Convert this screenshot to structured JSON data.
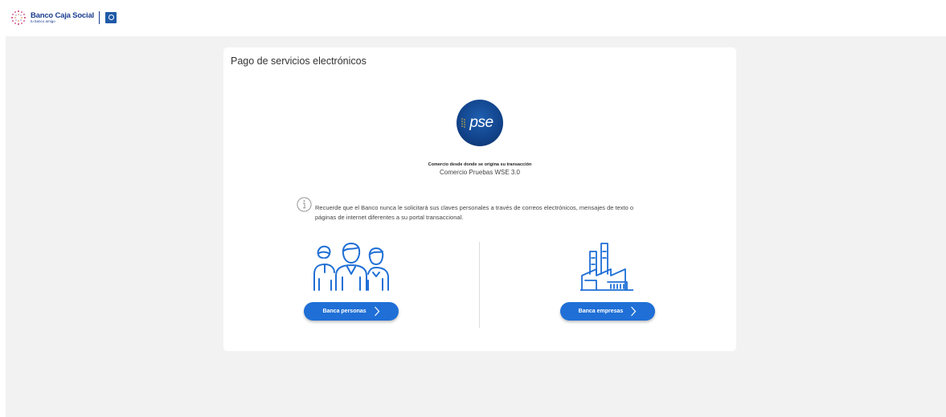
{
  "header": {
    "bank_name": "Banco Caja Social",
    "bank_tagline": "tu banco amigo",
    "brand_color": "#1b3d8f"
  },
  "main": {
    "title": "Pago de servicios electrónicos",
    "logo_text": "pse",
    "merchant_label": "Comercio desde donde se origina su transacción",
    "merchant_name": "Comercio Pruebas WSE 3.0",
    "notice": "Recuerde que el Banco nunca le solicitará sus claves personales a través de correos electrónicos, mensajes de texto o páginas de internet diferentes a su portal transaccional.",
    "icons": {
      "info": "info-circle-icon",
      "people": "people-group-icon",
      "factory": "factory-icon",
      "chevron": "chevron-right-icon"
    },
    "options": {
      "personas_label": "Banca personas",
      "empresas_label": "Banca empresas"
    },
    "accent_color": "#1f6fd6"
  }
}
